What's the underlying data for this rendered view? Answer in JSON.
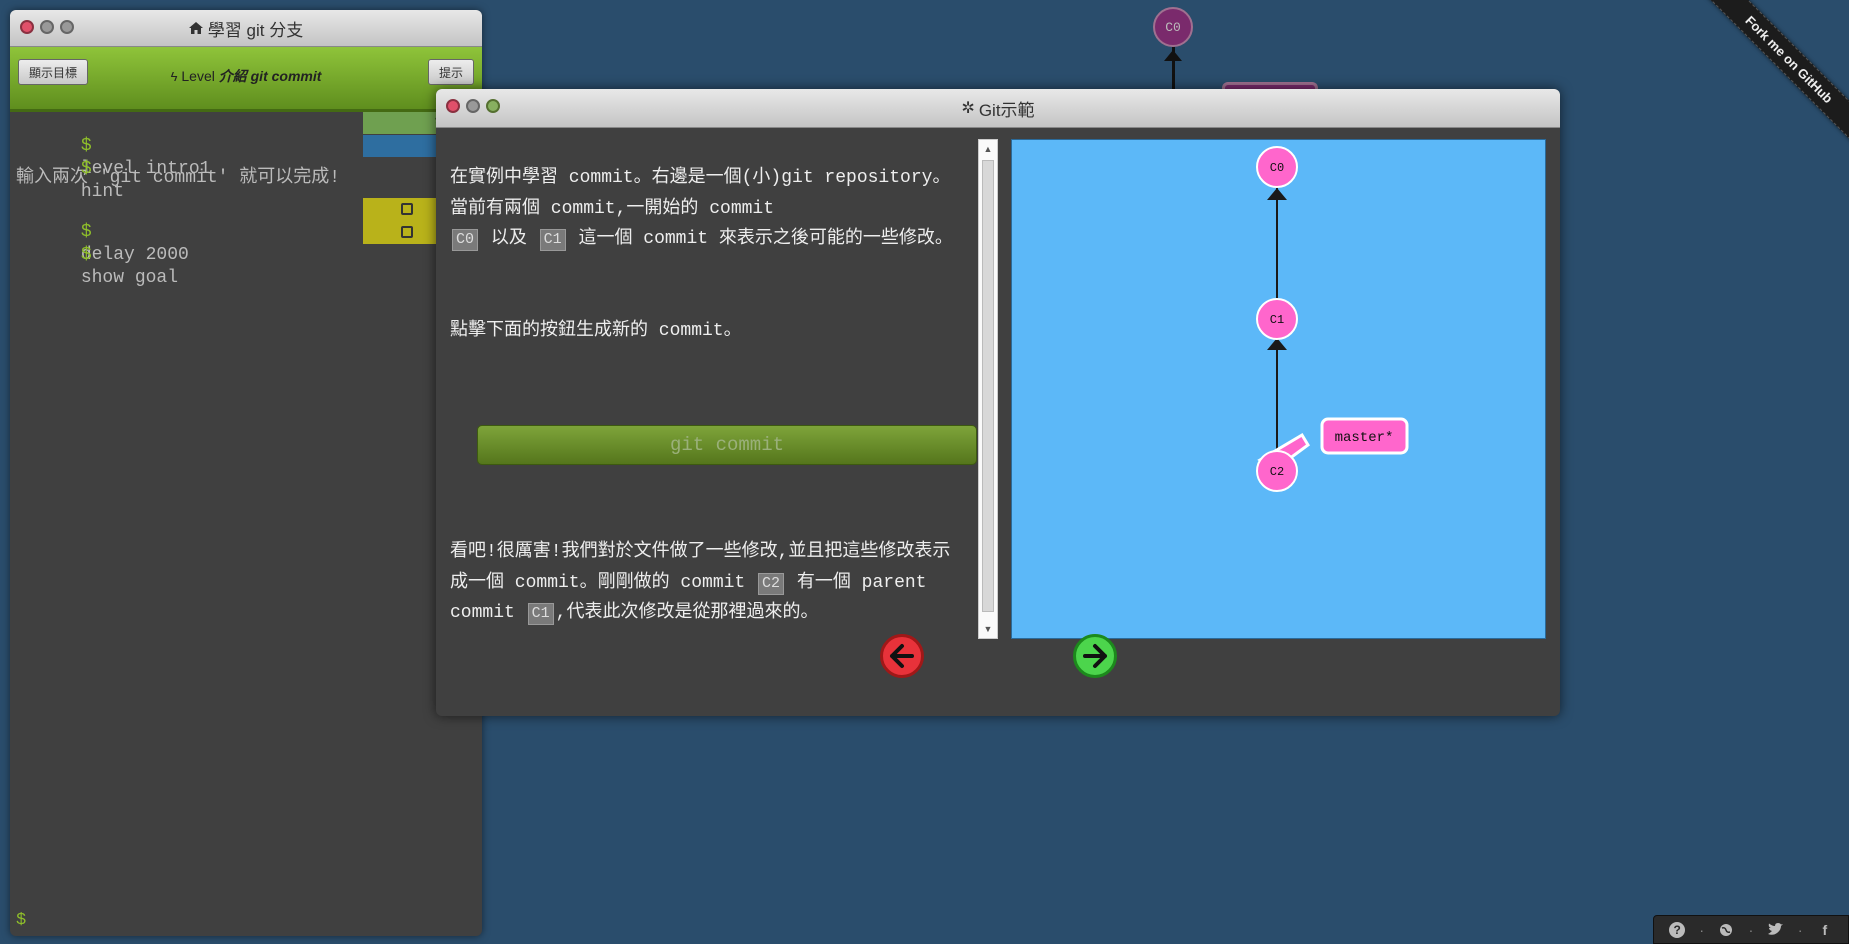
{
  "background_graph": {
    "node_label": "C0"
  },
  "ribbon": {
    "label": "Fork me on GitHub"
  },
  "command_window": {
    "title": "學習 git 分支",
    "show_goal_button": "顯示目標",
    "hint_button": "提示",
    "level_prefix": "Level",
    "level_name": "介紹 git commit",
    "lines": [
      {
        "prompt": "$",
        "text": "level intro1"
      },
      {
        "prompt": "$",
        "text": "hint"
      }
    ],
    "message": "輸入兩次 'git commit' 就可以完成!",
    "lines2": [
      {
        "prompt": "$",
        "text": "delay 2000"
      },
      {
        "prompt": "$",
        "text": "show goal"
      }
    ],
    "input_prompt": "$"
  },
  "dialog": {
    "title": "Git示範",
    "para1_a": "在實例中學習 commit。右邊是一個(小)git repository。當前有兩個 commit,一開始的 commit",
    "para1_tag1": "C0",
    "para1_b": "以及",
    "para1_tag2": "C1",
    "para1_c": "這一個 commit 來表示之後可能的一些修改。",
    "para2": "點擊下面的按鈕生成新的 commit。",
    "commit_button": "git commit",
    "para3_a": "看吧!很厲害!我們對於文件做了一些修改,並且把這些修改表示成一個 commit。剛剛做的 commit",
    "para3_tag1": "C2",
    "para3_b": "有一個 parent commit",
    "para3_tag2": "C1",
    "para3_c": ",代表此次修改是從那裡過來的。"
  },
  "visualization": {
    "nodes": [
      "C0",
      "C1",
      "C2"
    ],
    "branch_label": "master*",
    "node_color": "#ff66cc",
    "background_color": "#5cb8f8"
  },
  "colors": {
    "nav_back": "#e8323a",
    "nav_forward": "#4cd54c"
  },
  "bottom_bar": {
    "icons": [
      "help-icon",
      "globe-icon",
      "twitter-icon",
      "facebook-icon"
    ],
    "separator": "·"
  }
}
